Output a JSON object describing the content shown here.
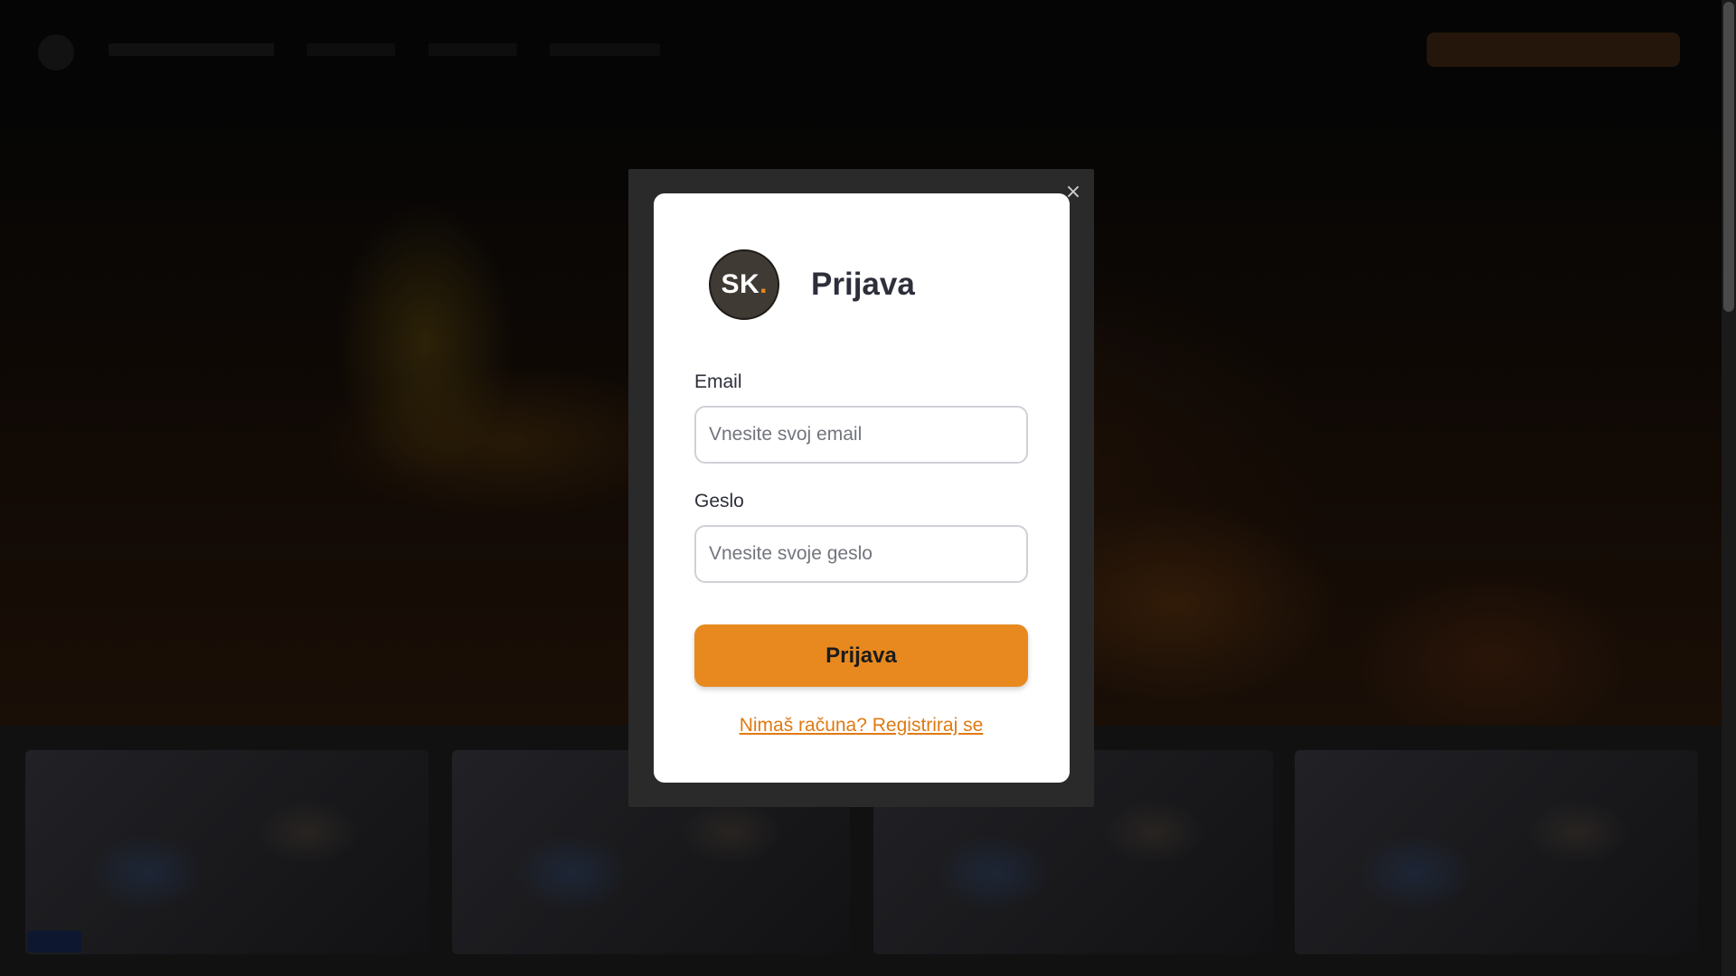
{
  "modal": {
    "logo": {
      "text": "SK",
      "dot": "."
    },
    "title": "Prijava",
    "close_symbol": "×",
    "email": {
      "label": "Email",
      "placeholder": "Vnesite svoj email",
      "value": ""
    },
    "password": {
      "label": "Geslo",
      "placeholder": "Vnesite svoje geslo",
      "value": ""
    },
    "submit_label": "Prijava",
    "register_link": "Nimaš računa? Registriraj se"
  },
  "colors": {
    "accent": "#e8891f",
    "link": "#e07a12",
    "title_text": "#2d2f3a",
    "modal_frame": "#2a2a2a",
    "logo_bg": "#3f3a34"
  },
  "icons": {
    "close": "close-icon",
    "logo": "sk-logo"
  }
}
